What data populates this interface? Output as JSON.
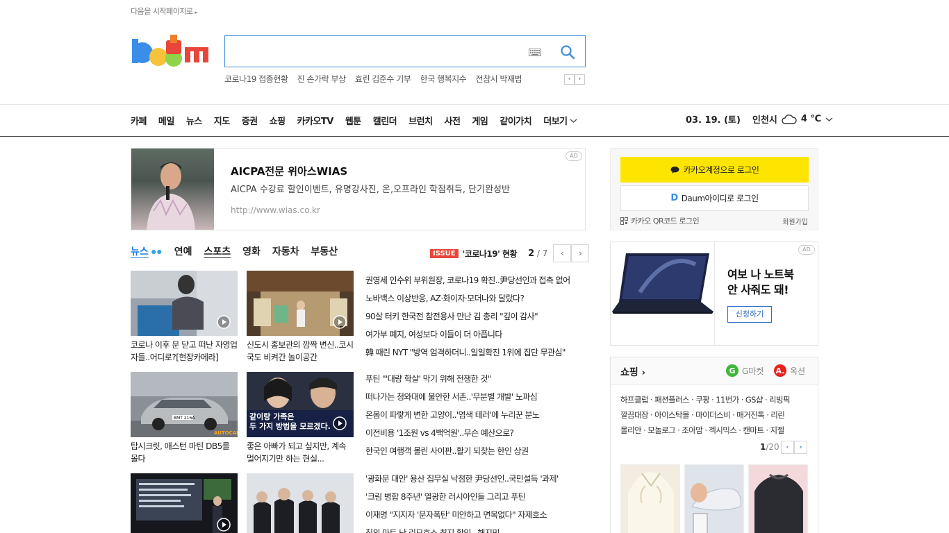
{
  "header": {
    "start_page": "다음을 시작페이지로"
  },
  "search": {
    "placeholder": "",
    "trending": [
      "코로나19 접종현황",
      "진 손가락 부상",
      "효린 김준수 기부",
      "한국 행복지수",
      "전참시 박재범"
    ]
  },
  "nav": {
    "items": [
      "카페",
      "메일",
      "뉴스",
      "지도",
      "증권",
      "쇼핑",
      "카카오TV",
      "웹툰",
      "캘린더",
      "브런치",
      "사전",
      "게임",
      "같이가치"
    ],
    "more": "더보기",
    "date": "03. 19. (토)",
    "city": "인천시",
    "temp": "4 ℃"
  },
  "ad_banner": {
    "title": "AICPA전문 위아스WIAS",
    "desc": "AICPA 수강료 할인이벤트, 유명강사진, 온,오프라인 학점취득, 단기완성반",
    "url": "http://www.wias.co.kr",
    "badge": "AD"
  },
  "news": {
    "tabs": [
      "뉴스",
      "연예",
      "스포츠",
      "영화",
      "자동차",
      "부동산"
    ],
    "issue_badge": "ISSUE",
    "issue_text": "'코로나19' 현황",
    "page_current": "2",
    "page_total": " / 7",
    "thumbs": [
      {
        "caption": "코로나 이후 문 닫고 떠난 자영업자들..어디로?[현장카메라]"
      },
      {
        "caption": "신도시 홍보관의 깜짝 변신..코시국도 비켜간 놀이공간"
      },
      {
        "caption": "탑시크릿, 애스턴 마틴 DB5를 몰다"
      },
      {
        "caption": "좋은 아빠가 되고 싶지만, 계속 멀어지기만 하는 현실..."
      },
      {
        "caption": ""
      },
      {
        "caption": ""
      }
    ],
    "thumb_overlay": "같이랑 가족은\n두 가지 방법을 모르겠다.",
    "car_plate": "BMT 216A",
    "car_brand": "AUTOCAR",
    "headlines_1": [
      "권영세 인수위 부위원장, 코로나19 확진..尹당선인과 접촉 없어",
      "노바백스 이상반응, AZ·화이자·모더나와 달랐다?",
      "90살 터키 한국전 참전용사 만난 김 총리 \"깊이 감사\"",
      "여가부 폐지, 여성보다 이들이 더 아픕니다",
      "韓 때린 NYT \"방역 엄격하더니..일일확진 1위에 집단 무관심\""
    ],
    "headlines_2": [
      "푸틴 \"'대량 학살' 막기 위해 전쟁한 것\"",
      "떠나가는 청와대에 불안한 서촌..'무분별 개발' 노파심",
      "온몸이 파랗게 변한 고양이..'염색 테러'에 누리꾼 분노",
      "이전비용 '1조원 vs 4백억원'..무슨 예산으로?",
      "한국인 여행객 몰린 사이판..활기 되찾는 한인 상권"
    ],
    "headlines_3": [
      "'광화문 대안' 용산 집무실 낙점한 尹당선인..국민설득 '과제'",
      "'크림 병합 8주년' 열광한 러시아인들 그리고 푸틴",
      "이재명 \"지지자 '문자폭탄' 미안하고 면목없다\" 자제호소",
      "침외 마트 난 리모호스 최지 할인...해지민"
    ]
  },
  "login": {
    "kakao": "카카오계정으로 로그인",
    "daum": "Daum아이디로 로그인",
    "daum_icon_letter": "D",
    "qr": "카카오 QR코드 로그인",
    "signup": "회원가입"
  },
  "ad_right": {
    "line1": "여보 나 노트북",
    "line2": "안 사줘도 돼!",
    "button": "신청하기",
    "badge": "AD"
  },
  "shopping": {
    "title": "쇼핑",
    "gmarket": "G마켓",
    "gmarket_letter": "G",
    "auction": "옥션",
    "auction_letter": "A.",
    "links": [
      "하프클럽 · 패션플러스 · 쿠팡 · 11번가 · GS샵 · 리빙픽",
      "깔끔대장 · 아이스탁몰 · 마이더스비 · 매거진톡 · 리린",
      "몰리안 · 모놀로그 · 조아맘 · 젝시믹스 · 캔마트 · 지젤"
    ],
    "page_current": "1",
    "page_total": "/20"
  },
  "colors": {
    "accent_blue": "#1c7ee8",
    "kakao_yellow": "#fee500",
    "issue_red": "#e8463b",
    "search_border": "#3d8cde"
  }
}
